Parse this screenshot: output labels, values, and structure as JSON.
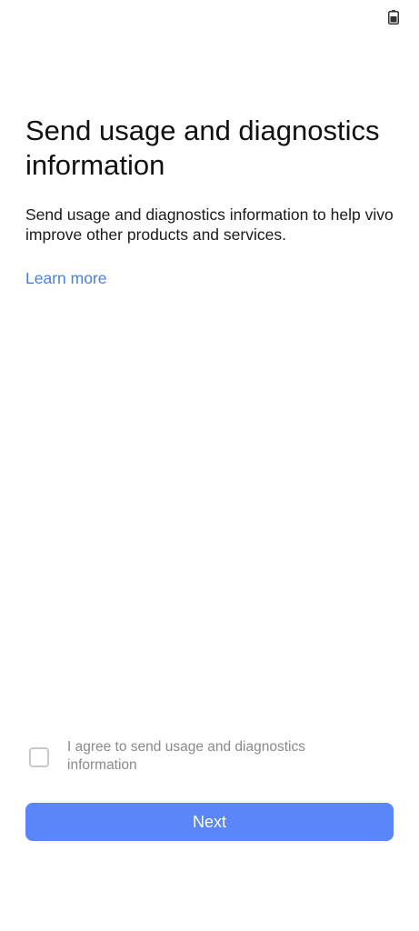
{
  "status_bar": {
    "battery_icon": "battery-icon"
  },
  "page": {
    "title": "Send usage and diagnostics information",
    "description": "Send usage and diagnostics information to help vivo improve other products and services.",
    "learn_more": "Learn more",
    "consent": {
      "checked": false,
      "label": "I agree to send usage and diagnostics information"
    },
    "next_button": "Next"
  },
  "colors": {
    "accent_link": "#4a7fe3",
    "button_bg": "#5b86f9",
    "muted_text": "#8a8a8a"
  }
}
